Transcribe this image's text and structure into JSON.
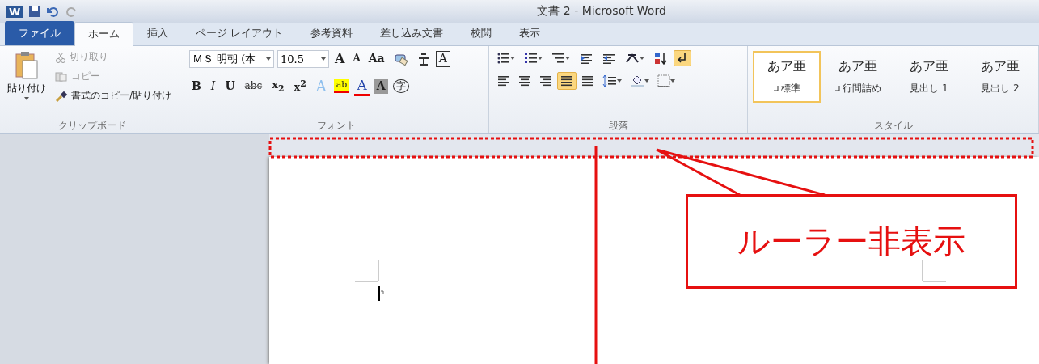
{
  "window": {
    "app_logo": "W",
    "title": "文書 2 - Microsoft Word"
  },
  "tabs": [
    {
      "label": "ファイル",
      "kind": "file",
      "selected": false
    },
    {
      "label": "ホーム",
      "kind": "tab",
      "selected": true
    },
    {
      "label": "挿入",
      "kind": "tab",
      "selected": false
    },
    {
      "label": "ページ レイアウト",
      "kind": "tab",
      "selected": false
    },
    {
      "label": "参考資料",
      "kind": "tab",
      "selected": false
    },
    {
      "label": "差し込み文書",
      "kind": "tab",
      "selected": false
    },
    {
      "label": "校閲",
      "kind": "tab",
      "selected": false
    },
    {
      "label": "表示",
      "kind": "tab",
      "selected": false
    }
  ],
  "clipboard": {
    "paste": "貼り付け",
    "group": "クリップボード",
    "items": [
      {
        "label": "切り取り",
        "kind": "cut",
        "disabled": true
      },
      {
        "label": "コピー",
        "kind": "copy",
        "disabled": true
      },
      {
        "label": "書式のコピー/貼り付け",
        "kind": "brush",
        "disabled": false
      }
    ]
  },
  "font": {
    "group": "フォント",
    "font_name": "ＭＳ 明朝 (本",
    "font_size": "10.5",
    "row1": [
      {
        "kind": "grow",
        "text": "A"
      },
      {
        "kind": "shrink",
        "text": "A"
      },
      {
        "kind": "case",
        "text": "Aa"
      },
      {
        "kind": "clear"
      },
      {
        "kind": "ruby"
      },
      {
        "kind": "boxed",
        "text": "A"
      }
    ],
    "row2": [
      {
        "kind": "bold",
        "text": "B"
      },
      {
        "kind": "italic",
        "text": "I"
      },
      {
        "kind": "underline",
        "text": "U"
      },
      {
        "kind": "strike",
        "text": "abc"
      },
      {
        "kind": "script",
        "text": "x$_{2}$"
      },
      {
        "kind": "script",
        "text": "x$^{2}$"
      },
      {
        "kind": "effects",
        "text": "A"
      },
      {
        "kind": "highlight",
        "text": "ab"
      },
      {
        "kind": "color",
        "text": "A"
      },
      {
        "kind": "shading",
        "text": "A"
      },
      {
        "kind": "enclosed",
        "text": "字"
      }
    ]
  },
  "paragraph": {
    "group": "段落",
    "show_marks": {
      "selected": true
    },
    "align": [
      {
        "selected": false
      },
      {
        "selected": false
      },
      {
        "selected": false
      },
      {
        "selected": true
      },
      {
        "selected": false
      }
    ]
  },
  "styles": {
    "group": "スタイル",
    "items": [
      {
        "sample": "あア亜",
        "name": "標準",
        "paragraph_mark": true,
        "selected": true
      },
      {
        "sample": "あア亜",
        "name": "行間詰め",
        "paragraph_mark": true,
        "selected": false
      },
      {
        "sample": "あア亜",
        "name": "見出し 1",
        "paragraph_mark": false,
        "selected": false
      },
      {
        "sample": "あア亜",
        "name": "見出し 2",
        "paragraph_mark": false,
        "selected": false
      }
    ]
  },
  "callout": {
    "text": "ルーラー非表示"
  }
}
